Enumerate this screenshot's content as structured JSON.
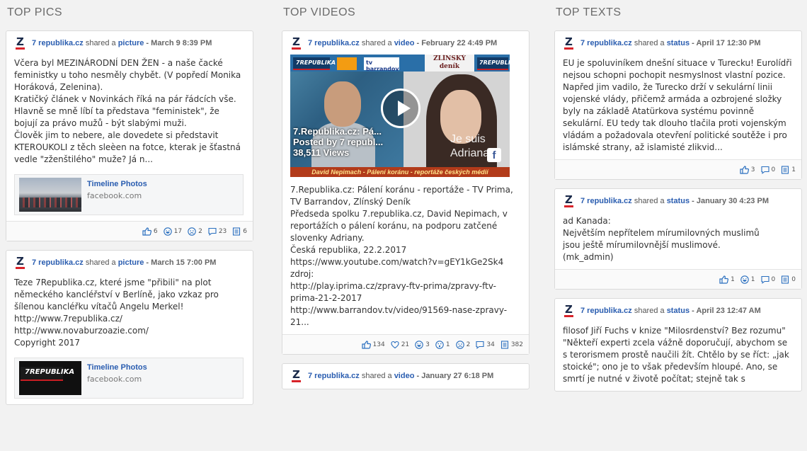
{
  "columns": [
    {
      "title": "TOP PICS",
      "cards": [
        {
          "name": "7 republika.cz",
          "action": " shared a ",
          "kind": "picture",
          "date": " - March 9 8:39 PM",
          "text": "Včera byl MEZINÁRODNÍ DEN ŽEN - a naše čacké feministky u toho nesměly chybět. (V popředí Monika Horáková, Zelenina).\nKratičký článek v Novinkách říká na pár řádcích vše. Hlavně se mně líbí ta představa \"feministek\", že bojují za právo mužů - být slabými muži.\nČlověk jim to nebere, ale dovedete si představit KTEROUKOLI z těch sleèen na fotce, kterak je šťastná vedle \"zženštilého\" muže? Já n...",
          "attachment": {
            "title": "Timeline Photos",
            "sub": "facebook.com"
          },
          "stats": [
            "6",
            "17",
            "2",
            "23",
            "6"
          ]
        },
        {
          "name": "7 republika.cz",
          "action": " shared a ",
          "kind": "picture",
          "date": " - March 15 7:00 PM",
          "text": "Teze 7Republika.cz, které jsme \"přibili\" na plot německého kancléřství v Berlíně, jako vzkaz pro šílenou kancléřku vítačů Angelu Merkel!\nhttp://www.7republika.cz/\nhttp://www.novaburzoazie.com/\nCopyright 2017",
          "attachment": {
            "title": "Timeline Photos",
            "sub": "facebook.com",
            "logo": "7REPUBLIKA"
          }
        }
      ]
    },
    {
      "title": "TOP VIDEOS",
      "cards": [
        {
          "name": "7 republika.cz",
          "action": " shared a ",
          "kind": "video",
          "date": " - February 22 4:49 PM",
          "video": {
            "overlay_title": "7.Republika.cz: Pá...",
            "overlay_posted": "Posted by 7 republ...",
            "overlay_views": "38,511 Views",
            "caption": "David Nepimach - Pálení koránu - reportáže českých médií",
            "badge_left": "7REPUBLIKA",
            "badge_tv": "tv barrandov",
            "badge_news": "ZLÍNSKÝ deník",
            "badge_right": "7REPUBLIKA",
            "jesuis": "Je suis Adriana",
            "fb": "f"
          },
          "text": "7.Republika.cz: Pálení koránu - reportáže - TV Prima, TV Barrandov, Zlínský Deník\nPředseda spolku 7.republika.cz, David Nepimach, v reportážích o pálení koránu, na podporu zatčené slovenky Adriany.\nČeská republika, 22.2.2017\nhttps://www.youtube.com/watch?v=gEY1kGe2Sk4\nzdroj:\nhttp://play.iprima.cz/zpravy-ftv-prima/zpravy-ftv-prima-21-2-2017\nhttp://www.barrandov.tv/video/91569-nase-zpravy-21...",
          "stats7": [
            "134",
            "21",
            "3",
            "1",
            "2",
            "34",
            "382"
          ]
        },
        {
          "name": "7 republika.cz",
          "action": " shared a ",
          "kind": "video",
          "date": " - January 27 6:18 PM"
        }
      ]
    },
    {
      "title": "TOP TEXTS",
      "cards": [
        {
          "name": "7 republika.cz",
          "action": " shared a ",
          "kind": "status",
          "date": " - April 17 12:30 PM",
          "text": "EU je spoluviníkem dnešní situace v Turecku! Eurolídři nejsou schopni pochopit nesmyslnost vlastní pozice. Napřed jim vadilo, že Turecko drží v sekulární linii vojenské vlády, přičemž armáda a ozbrojené složky byly na základě Atatürkova systému povinně sekulární. EU tedy tak dlouho tlačila proti vojenským vládám a požadovala otevření politické soutěže i pro islámské strany, až islamisté zlikvid...",
          "stats3": [
            "3",
            "0",
            "1"
          ]
        },
        {
          "name": "7 republika.cz",
          "action": " shared a ",
          "kind": "status",
          "date": " - January 30 4:23 PM",
          "text": "ad Kanada:\nNejvětším nepřítelem mírumilovných muslimů\njsou ještě mírumilovnější muslimové.\n(mk_admin)",
          "stats4": [
            "1",
            "1",
            "0",
            "0"
          ]
        },
        {
          "name": "7 republika.cz",
          "action": " shared a ",
          "kind": "status",
          "date": " - April 23 12:47 AM",
          "text": "filosof Jiří Fuchs v knize \"Milosrdenství? Bez rozumu\" \"Někteří experti zcela vážně doporučují, abychom se s terorismem prostě naučili žít. Chtělo by se říct: „jak stoické\"; ono je to však především hloupé. Ano, se smrtí je nutné v životě počítat; stejně tak s"
        }
      ]
    }
  ]
}
